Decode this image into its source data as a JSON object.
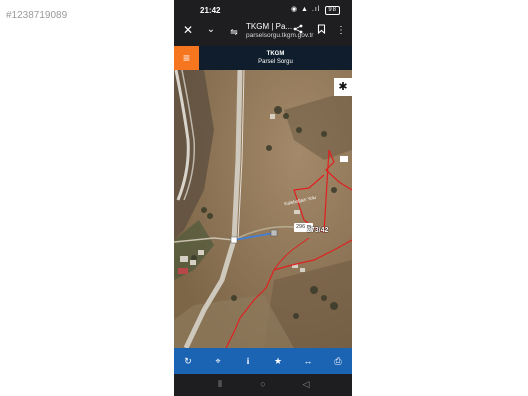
{
  "watermark": "#1238719089",
  "status": {
    "time": "21:42",
    "icons": "◉ ▲ .ıl",
    "battery": "98"
  },
  "browser": {
    "close_glyph": "✕",
    "down_glyph": "⌄",
    "tune_glyph": "⇋",
    "title": "TKGM | Pa...",
    "url": "parselsorgu.tkgm.gov.tr",
    "share_glyph": "<",
    "bookmark_glyph": "▯",
    "more_glyph": "⋮"
  },
  "app": {
    "menu_glyph": "≡",
    "title": "TKGM",
    "subtitle": "Parsel Sorgu"
  },
  "map": {
    "settings_glyph": "✱",
    "distance": "296 m",
    "parcel": "273/42",
    "road_label": "Kaleboğazı Yolu"
  },
  "toolbar": {
    "refresh": "↻",
    "locate": "⌖",
    "info": "i",
    "favorite": "★",
    "measure": "↔",
    "print": "⎙"
  },
  "navbar": {
    "recents": "⦀",
    "home": "○",
    "back": "◁"
  },
  "colors": {
    "header": "#0f1d2c",
    "menu": "#f5761f",
    "toolbar": "#1b63b3",
    "parcel_boundary": "#e02020",
    "measure_line": "#3f7fd8"
  }
}
